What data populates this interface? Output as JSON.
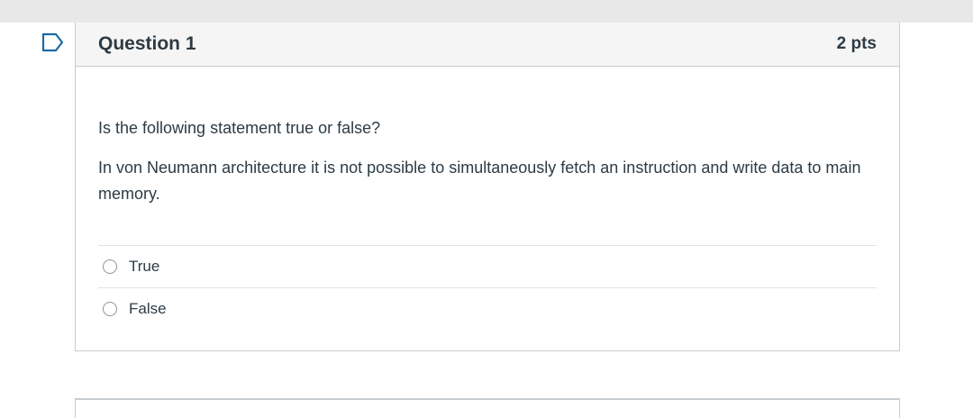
{
  "question": {
    "title": "Question 1",
    "points": "2 pts",
    "prompt": "Is the following statement true or false?",
    "statement": "In von Neumann architecture it is not possible to simultaneously fetch an instruction and write data to main memory.",
    "answers": [
      {
        "label": "True"
      },
      {
        "label": "False"
      }
    ]
  },
  "colors": {
    "text": "#2d3b45",
    "border": "#c7cdd1",
    "header_bg": "#f5f5f5",
    "flag": "#1c6ba5"
  },
  "icons": {
    "flag": "flag-question-icon",
    "radio": "radio-button-icon"
  }
}
